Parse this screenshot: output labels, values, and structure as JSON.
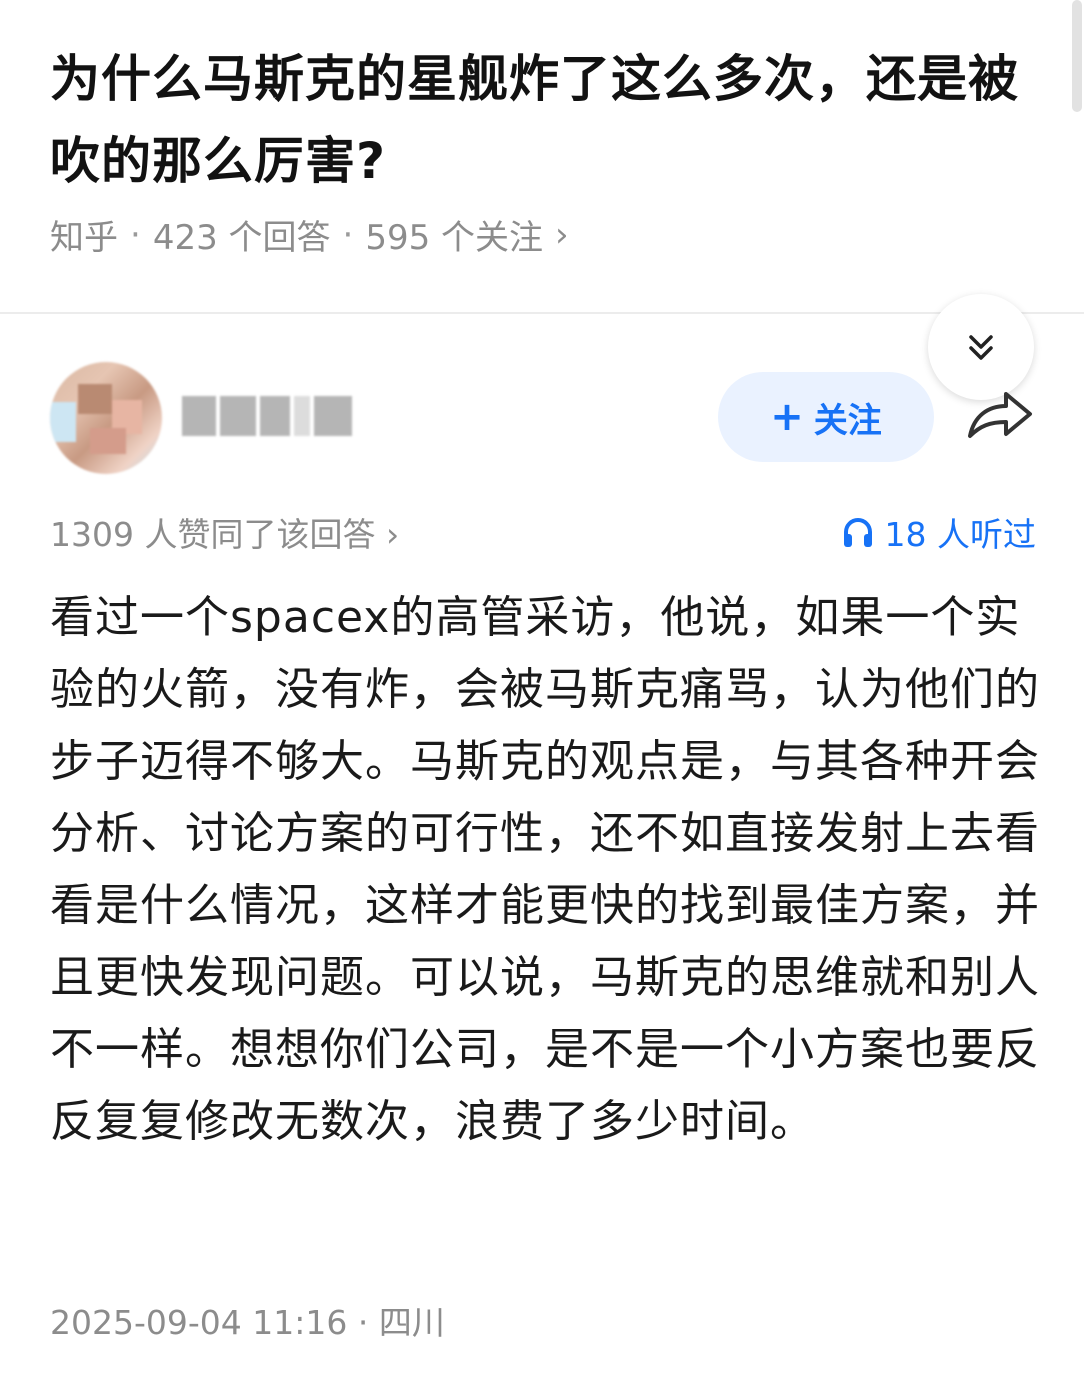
{
  "question": {
    "title": "为什么马斯克的星舰炸了这么多次，还是被吹的那么厉害?"
  },
  "meta": {
    "source": "知乎",
    "answers": "423 个回答",
    "followers": "595 个关注",
    "separator": "·",
    "chevron": "›"
  },
  "author": {
    "follow_label": "关注",
    "plus": "+"
  },
  "stats": {
    "approve_text": "1309 人赞同了该回答",
    "chevron": "›",
    "listen_text": "18 人听过"
  },
  "answer": {
    "body": "看过一个spacex的高管采访，他说，如果一个实验的火箭，没有炸，会被马斯克痛骂，认为他们的步子迈得不够大。马斯克的观点是，与其各种开会分析、讨论方案的可行性，还不如直接发射上去看看是什么情况，这样才能更快的找到最佳方案，并且更快发现问题。可以说，马斯克的思维就和别人不一样。想想你们公司，是不是一个小方案也要反反复复修改无数次，浪费了多少时间。"
  },
  "footer": {
    "timestamp_location": "2025-09-04 11:16 · 四川"
  },
  "icons": {
    "expand": "chevrons-down-icon",
    "share": "share-arrow-icon",
    "listen": "headphones-icon"
  },
  "colors": {
    "accent": "#1772f6",
    "follow_bg": "#eaf2ff",
    "muted_text": "#8c8c8c",
    "body_text": "#1a1a1a"
  }
}
